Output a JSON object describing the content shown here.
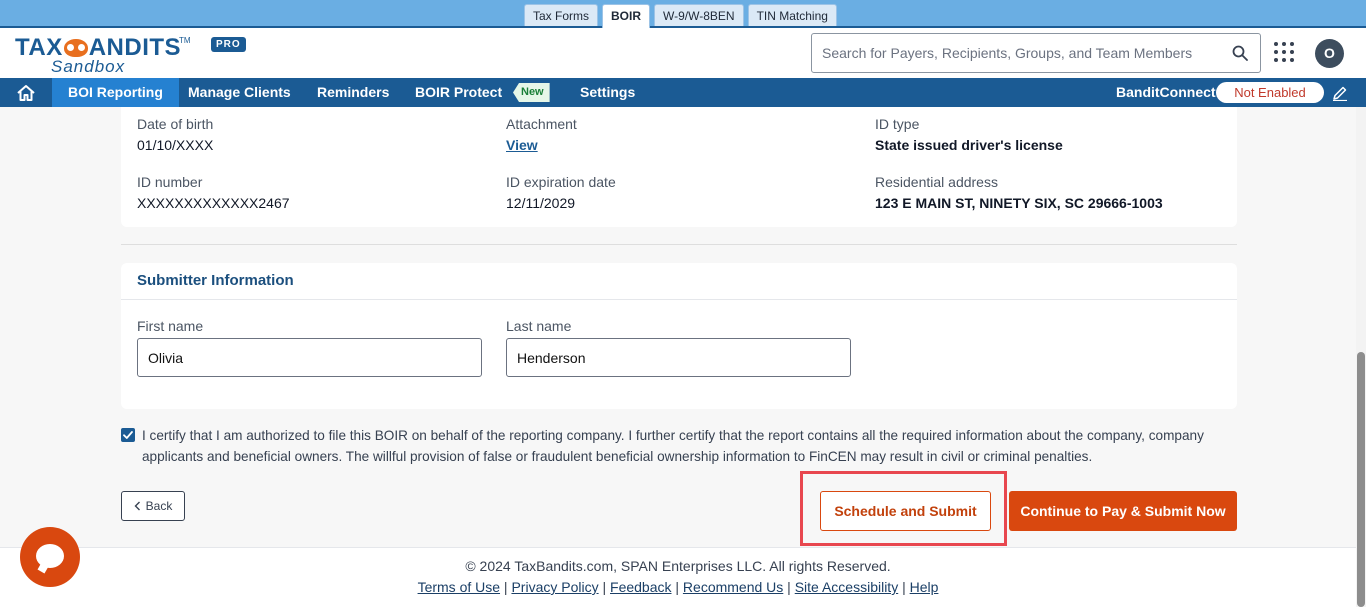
{
  "product_tabs": [
    "Tax Forms",
    "BOIR",
    "W-9/W-8BEN",
    "TIN Matching"
  ],
  "product_tab_active": "BOIR",
  "logo": {
    "main": "TAX",
    "main2": "ANDITS",
    "tm": "TM",
    "sub": "Sandbox",
    "badge": "PRO"
  },
  "search": {
    "placeholder": "Search for Payers, Recipients, Groups, and Team Members",
    "icon": "search-icon"
  },
  "avatar_initial": "O",
  "nav": {
    "items": [
      "BOI Reporting",
      "Manage Clients",
      "Reminders",
      "BOIR Protect",
      "Settings"
    ],
    "active": "BOI Reporting",
    "new_badge": "New",
    "bandit_connect_label": "BanditConnect:",
    "bandit_connect_status": "Not Enabled"
  },
  "owner_details": {
    "dob_label": "Date of birth",
    "dob_value": "01/10/XXXX",
    "attachment_label": "Attachment",
    "attachment_link": "View",
    "id_type_label": "ID type",
    "id_type_value": "State issued driver's license",
    "id_number_label": "ID number",
    "id_number_value": "XXXXXXXXXXXXX2467",
    "id_exp_label": "ID expiration date",
    "id_exp_value": "12/11/2029",
    "address_label": "Residential address",
    "address_value": "123 E MAIN ST, NINETY SIX, SC 29666-1003"
  },
  "submitter": {
    "title": "Submitter Information",
    "first_name_label": "First name",
    "first_name_value": "Olivia",
    "last_name_label": "Last name",
    "last_name_value": "Henderson"
  },
  "certification": {
    "checked": true,
    "text": "I certify that I am authorized to file this BOIR on behalf of the reporting company. I further certify that the report contains all the required information about the company, company applicants and beneficial owners. The willful provision of false or fraudulent beneficial ownership information to FinCEN may result in civil or criminal penalties."
  },
  "actions": {
    "back": "Back",
    "schedule": "Schedule and Submit",
    "continue": "Continue to Pay & Submit Now"
  },
  "footer": {
    "copyright": "© 2024 TaxBandits.com, SPAN Enterprises LLC. All rights Reserved.",
    "links": [
      "Terms of Use",
      "Privacy Policy",
      "Feedback",
      "Recommend Us",
      " Site Accessibility",
      "Help"
    ]
  },
  "colors": {
    "brand": "#1b5b94",
    "accent": "#d9480f",
    "nav_active": "#2581d1",
    "highlight": "#e8474f"
  }
}
